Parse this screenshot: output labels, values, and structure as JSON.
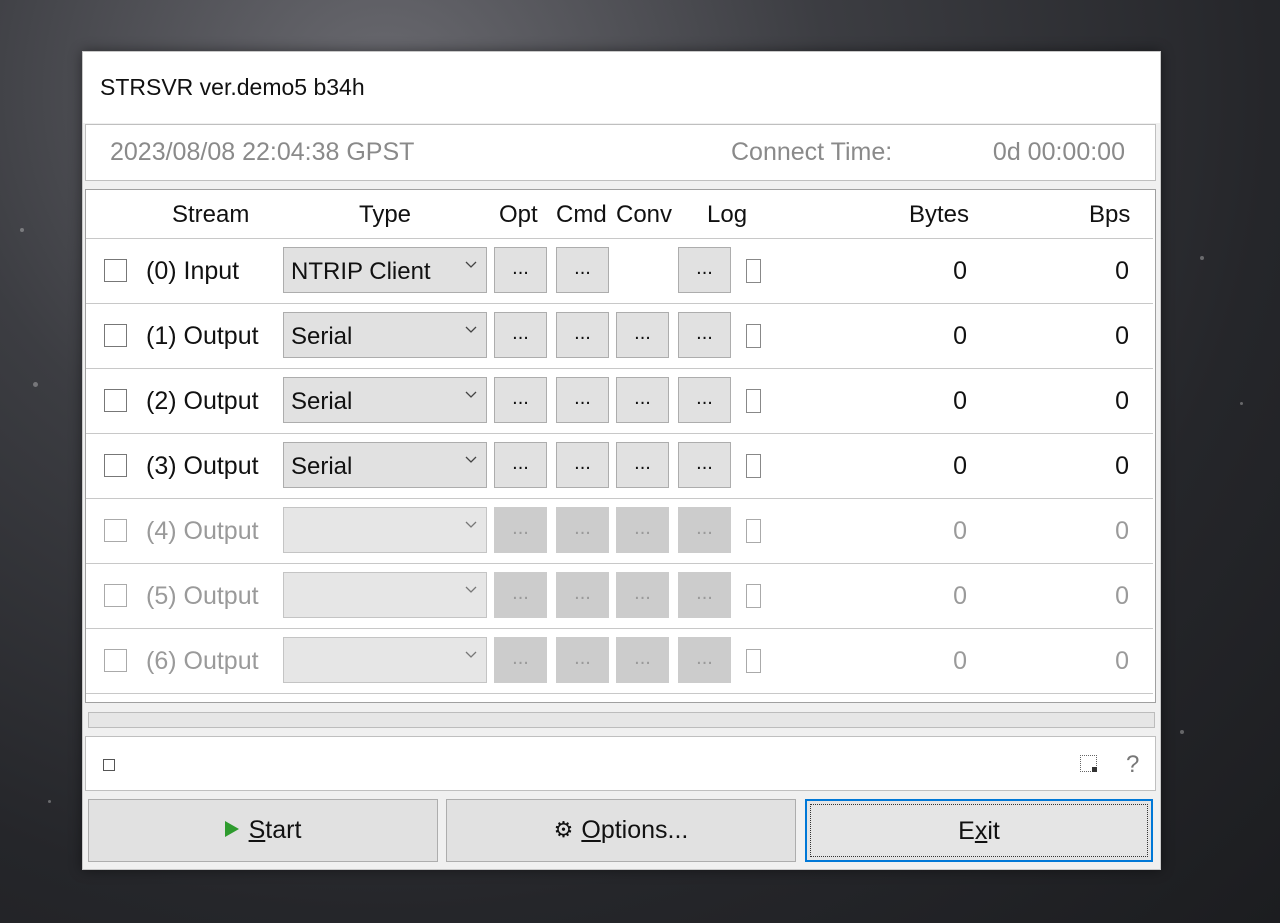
{
  "window": {
    "title": "STRSVR ver.demo5 b34h"
  },
  "status": {
    "datetime": "2023/08/08 22:04:38 GPST",
    "connect_label": "Connect Time:",
    "connect_value": "0d 00:00:00"
  },
  "headers": {
    "stream": "Stream",
    "type": "Type",
    "opt": "Opt",
    "cmd": "Cmd",
    "conv": "Conv",
    "log": "Log",
    "bytes": "Bytes",
    "bps": "Bps"
  },
  "rows": [
    {
      "label": "(0) Input",
      "type": "NTRIP Client",
      "opt": "...",
      "cmd": "...",
      "conv": "",
      "log": "...",
      "bytes": "0",
      "bps": "0",
      "enabled": true
    },
    {
      "label": "(1) Output",
      "type": "Serial",
      "opt": "...",
      "cmd": "...",
      "conv": "...",
      "log": "...",
      "bytes": "0",
      "bps": "0",
      "enabled": true
    },
    {
      "label": "(2) Output",
      "type": "Serial",
      "opt": "...",
      "cmd": "...",
      "conv": "...",
      "log": "...",
      "bytes": "0",
      "bps": "0",
      "enabled": true
    },
    {
      "label": "(3) Output",
      "type": "Serial",
      "opt": "...",
      "cmd": "...",
      "conv": "...",
      "log": "...",
      "bytes": "0",
      "bps": "0",
      "enabled": true
    },
    {
      "label": "(4) Output",
      "type": "",
      "opt": "...",
      "cmd": "...",
      "conv": "...",
      "log": "...",
      "bytes": "0",
      "bps": "0",
      "enabled": false
    },
    {
      "label": "(5) Output",
      "type": "",
      "opt": "...",
      "cmd": "...",
      "conv": "...",
      "log": "...",
      "bytes": "0",
      "bps": "0",
      "enabled": false
    },
    {
      "label": "(6) Output",
      "type": "",
      "opt": "...",
      "cmd": "...",
      "conv": "...",
      "log": "...",
      "bytes": "0",
      "bps": "0",
      "enabled": false
    }
  ],
  "message_bar": {
    "help": "?"
  },
  "buttons": {
    "start": {
      "accel": "S",
      "rest": "tart"
    },
    "options": {
      "accel": "O",
      "rest": "ptions..."
    },
    "exit": {
      "pre": "E",
      "accel": "x",
      "rest": "it"
    }
  },
  "colors": {
    "accent": "#0078d7",
    "play_icon": "#2e9b2e"
  }
}
